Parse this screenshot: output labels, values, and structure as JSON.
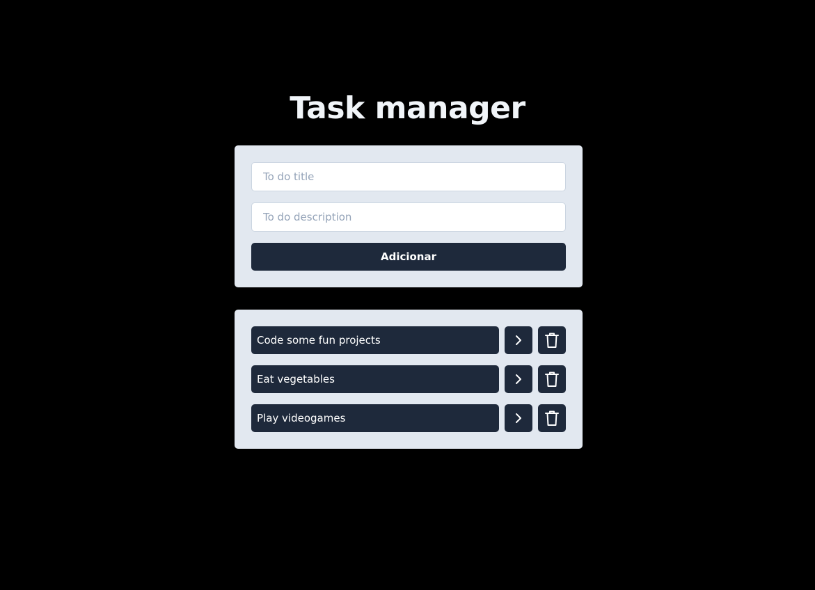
{
  "header": {
    "title": "Task manager"
  },
  "form": {
    "title_placeholder": "To do title",
    "description_placeholder": "To do description",
    "add_label": "Adicionar"
  },
  "tasks": [
    {
      "title": "Code some fun projects"
    },
    {
      "title": "Eat vegetables"
    },
    {
      "title": "Play videogames"
    }
  ],
  "icons": {
    "open": "chevron-right-icon",
    "delete": "trash-icon"
  },
  "colors": {
    "background": "#000000",
    "card": "#e2e8f0",
    "button": "#1e293b",
    "title_text": "#f1f5f9"
  }
}
